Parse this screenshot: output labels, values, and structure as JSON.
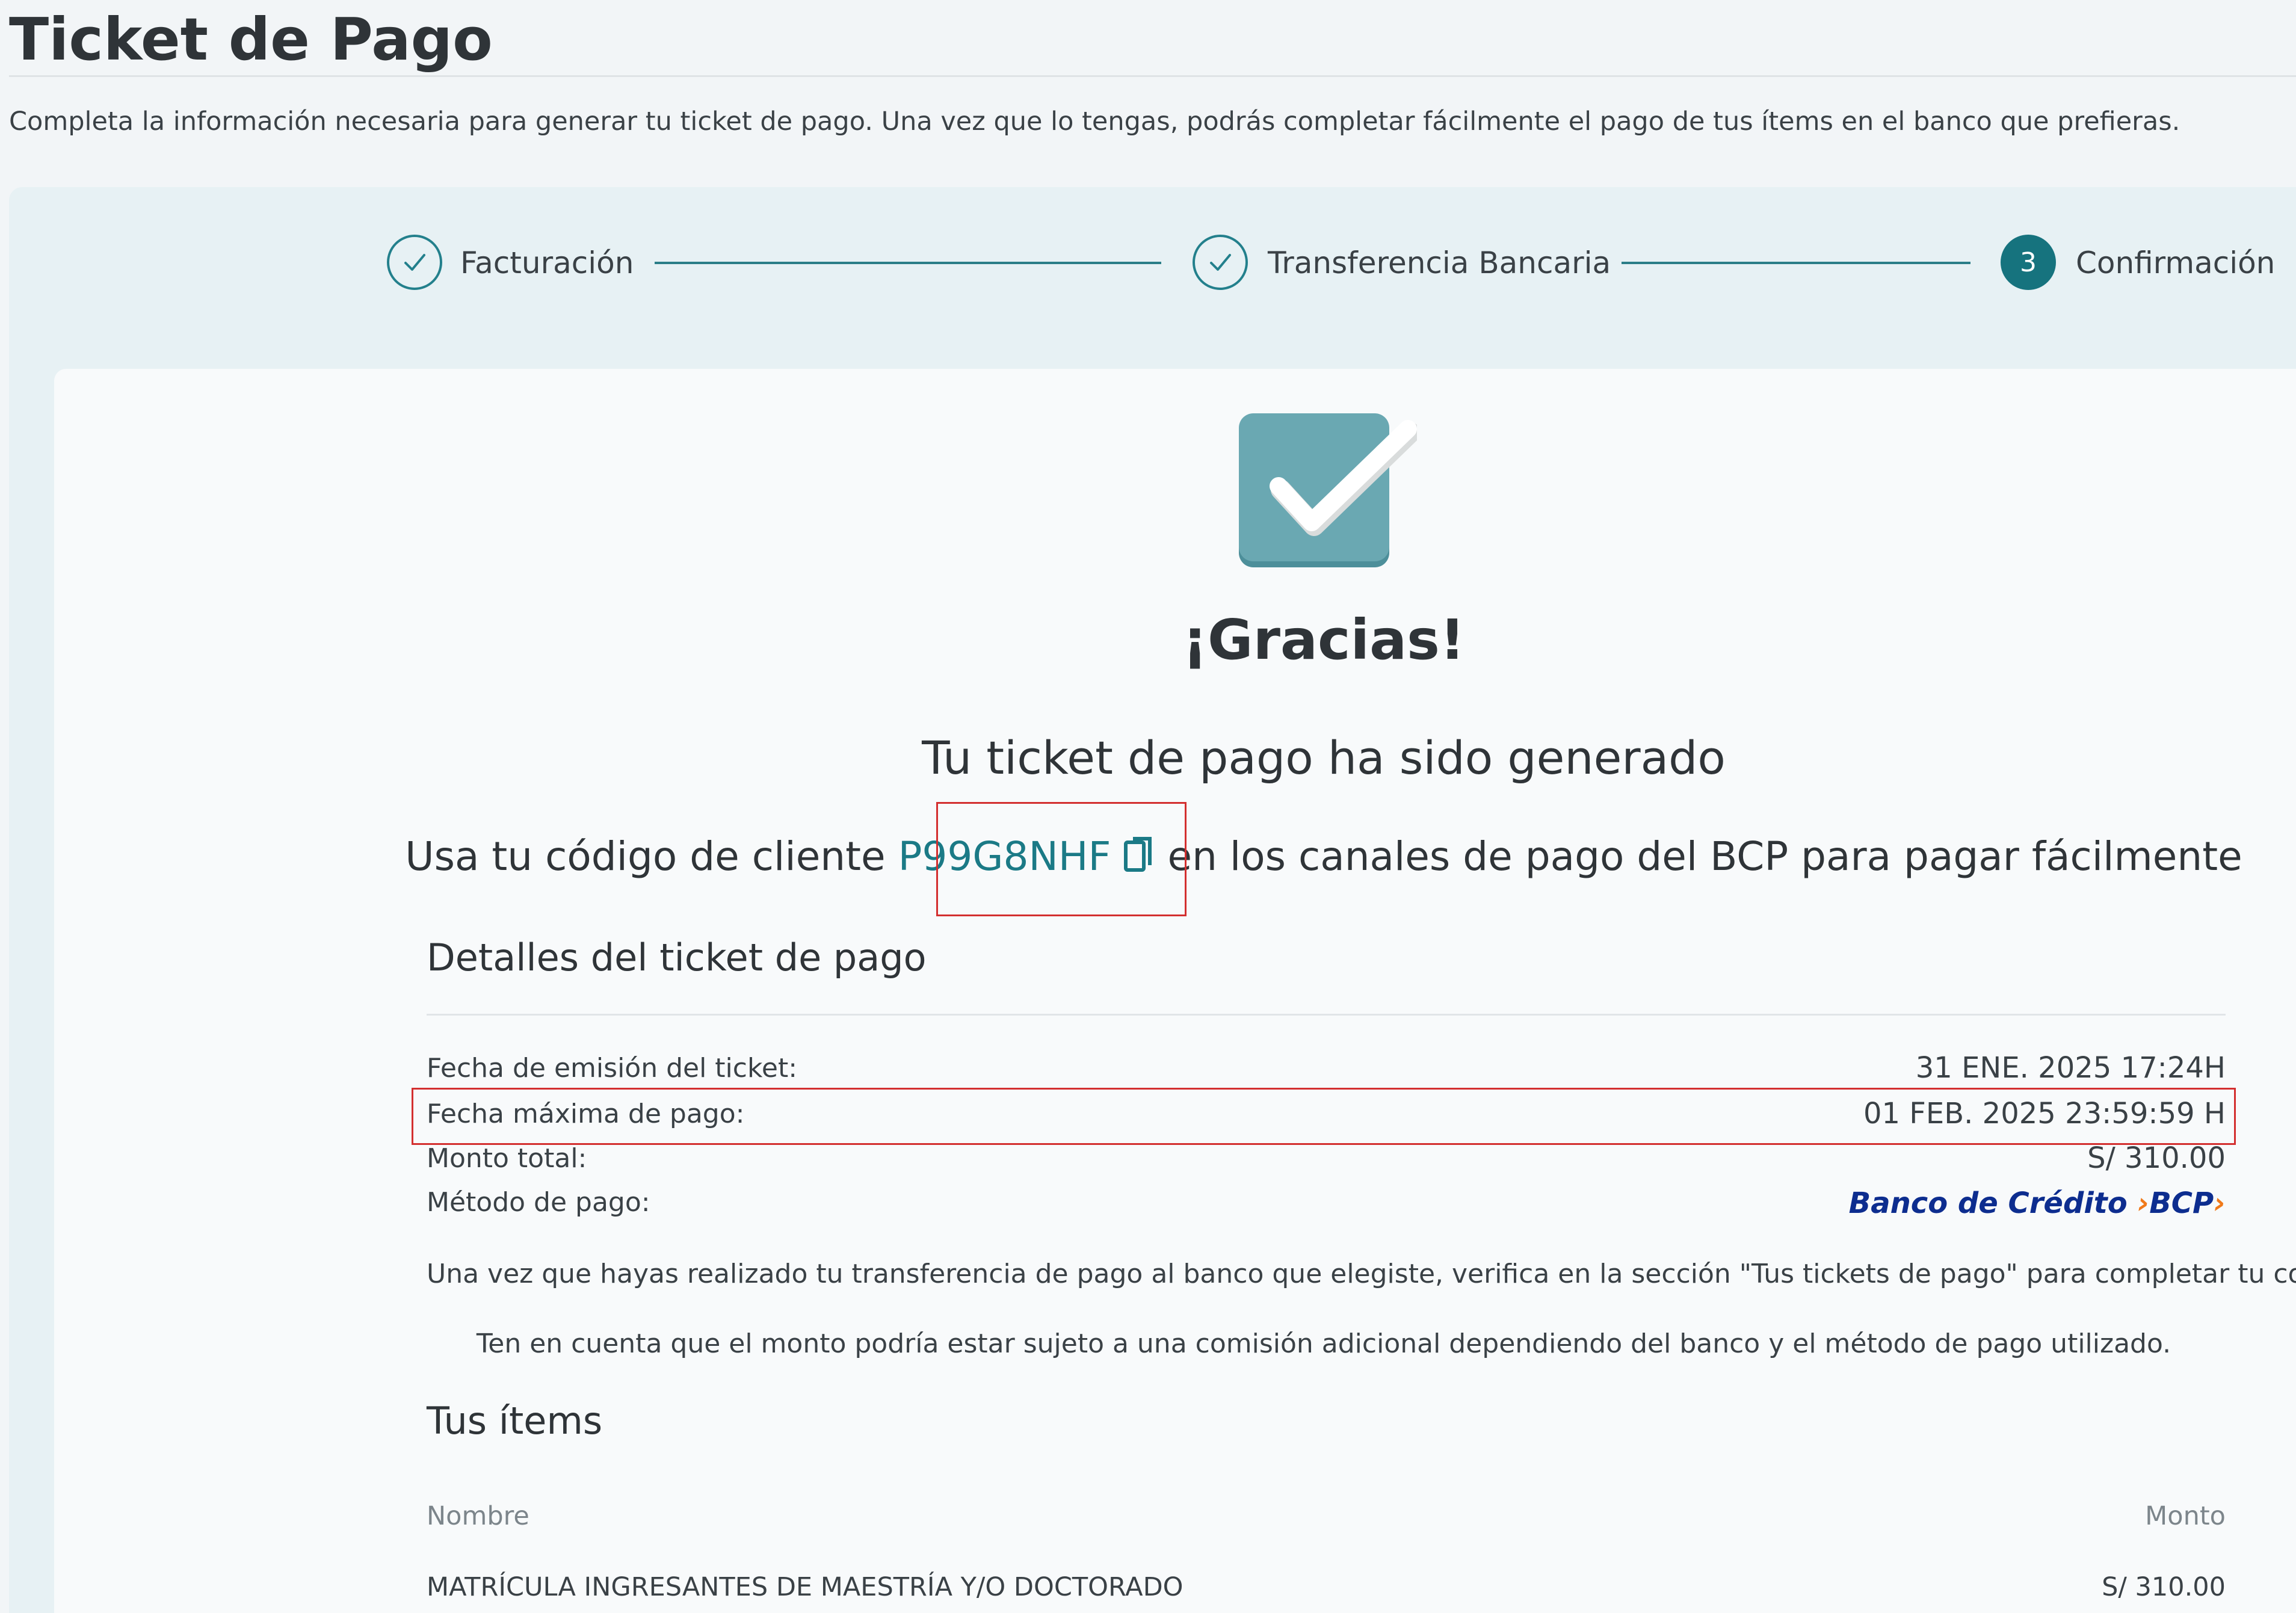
{
  "header": {
    "title": "Ticket de Pago",
    "intro": "Completa la información necesaria para generar tu ticket de pago. Una vez que lo tengas, podrás completar fácilmente el pago de tus ítems en el banco que prefieras."
  },
  "stepper": {
    "steps": [
      {
        "label": "Facturación",
        "state": "done"
      },
      {
        "label": "Transferencia Bancaria",
        "state": "done"
      },
      {
        "label": "Confirmación",
        "state": "active",
        "number": "3"
      }
    ]
  },
  "confirmation": {
    "heading": "¡Gracias!",
    "subheading": "Tu ticket de pago ha sido generado",
    "client_prefix": "Usa tu código de cliente",
    "client_code": "P99G8NHF",
    "client_suffix": "en los canales de pago del BCP para pagar fácilmente"
  },
  "details": {
    "title": "Detalles del ticket de pago",
    "rows": [
      {
        "label": "Fecha de emisión del ticket:",
        "value": "31 ENE. 2025 17:24H"
      },
      {
        "label": "Fecha máxima de pago:",
        "value": "01 FEB. 2025 23:59:59 H"
      },
      {
        "label": "Monto total:",
        "value": "S/ 310.00"
      },
      {
        "label": "Método de pago:",
        "value": ""
      }
    ],
    "bank": {
      "name": "Banco de Crédito",
      "arrow_left": "›",
      "code": "BCP",
      "arrow_right": "›"
    },
    "note1": "Una vez que hayas realizado tu transferencia de pago al banco que elegiste, verifica en la sección \"Tus tickets de pago\" para completar tu compra.",
    "note2": "Ten en cuenta que el monto podría estar sujeto a una comisión adicional dependiendo del banco y el método de pago utilizado."
  },
  "items": {
    "title": "Tus ítems",
    "columns": {
      "name": "Nombre",
      "amount": "Monto"
    },
    "rows": [
      {
        "name": "MATRÍCULA INGRESANTES DE MAESTRÍA Y/O DOCTORADO",
        "amount": "S/ 310.00"
      }
    ]
  },
  "colors": {
    "accent": "#16737e",
    "highlight": "#d32f2f",
    "panel": "#e7f1f4",
    "bank_blue": "#0d2d8f",
    "bank_orange": "#f07a1a"
  },
  "icons": {
    "step_done": "check-circle-icon",
    "success": "check-badge-icon",
    "copy": "copy-icon"
  }
}
